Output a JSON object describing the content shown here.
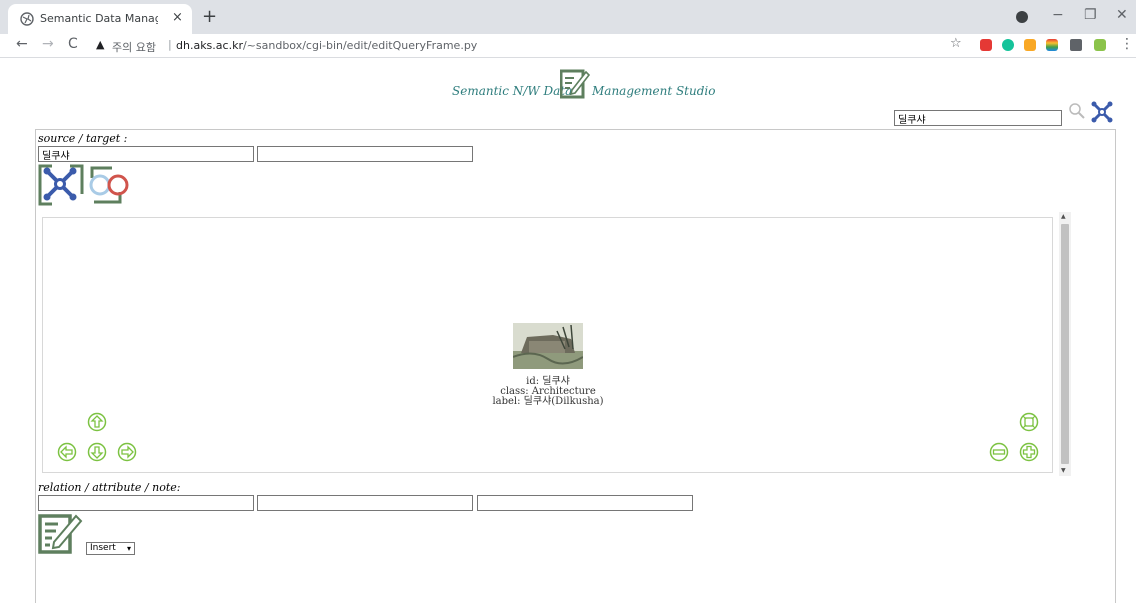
{
  "browser": {
    "tab_title": "Semantic Data Management St",
    "tab_close": "×",
    "new_tab": "+",
    "security_warning": "주의 요함",
    "url_host": "dh.aks.ac.kr",
    "url_path": "/~sandbox/cgi-bin/edit/editQueryFrame.py",
    "separator": "|",
    "back": "←",
    "forward": "→",
    "reload": "C",
    "minimize": "−",
    "restore": "❐",
    "close": "✕",
    "bookmark_star": "☆",
    "menu": "⋮"
  },
  "header": {
    "title_left": "Semantic N/W Data",
    "title_right": "Management Studio"
  },
  "global_search": {
    "value": "딜쿠샤"
  },
  "source_target": {
    "label": "source / target :",
    "source_value": "딜쿠샤",
    "target_value": ""
  },
  "graph": {
    "node": {
      "id_line": "id: 딜쿠샤",
      "class_line": "class: Architecture",
      "label_line": "label: 딜쿠샤(Dilkusha)"
    }
  },
  "relation": {
    "label": "relation / attribute / note:",
    "relation_value": "",
    "attribute_value": "",
    "note_value": ""
  },
  "action": {
    "selected": "Insert"
  },
  "colors": {
    "accent_teal": "#2e7d7d",
    "network_blue": "#3b5bab",
    "control_green": "#7cc242",
    "frame_green": "#5e7f5e"
  }
}
